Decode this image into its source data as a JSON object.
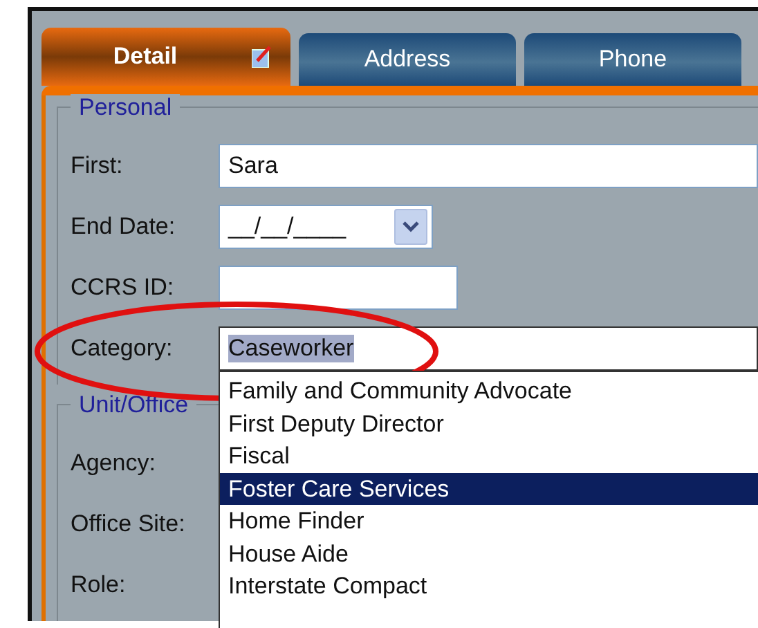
{
  "tabs": [
    {
      "label": "Detail",
      "selected": true,
      "edited": true
    },
    {
      "label": "Address",
      "selected": false,
      "edited": false
    },
    {
      "label": "Phone",
      "selected": false,
      "edited": false
    }
  ],
  "personal": {
    "legend": "Personal",
    "fields": [
      {
        "kind": "text",
        "label": "First:",
        "value": "Sara"
      },
      {
        "kind": "date",
        "label": "End Date:",
        "value": "__/__/____"
      },
      {
        "kind": "short",
        "label": "CCRS ID:"
      },
      {
        "kind": "combo",
        "label": "Category:",
        "value": "Caseworker",
        "expanded": true,
        "options": [
          {
            "label": "Family and Community Advocate",
            "selected": false
          },
          {
            "label": "First Deputy Director",
            "selected": false
          },
          {
            "label": "Fiscal",
            "selected": false
          },
          {
            "label": "Foster Care Services",
            "selected": true
          },
          {
            "label": "Home Finder",
            "selected": false
          },
          {
            "label": "House Aide",
            "selected": false
          },
          {
            "label": "Interstate Compact",
            "selected": false
          }
        ]
      }
    ]
  },
  "unit_office": {
    "legend": "Unit/Office",
    "fields": [
      {
        "label": "Agency:"
      },
      {
        "label": "Office Site:"
      },
      {
        "label": "Role:"
      }
    ]
  }
}
